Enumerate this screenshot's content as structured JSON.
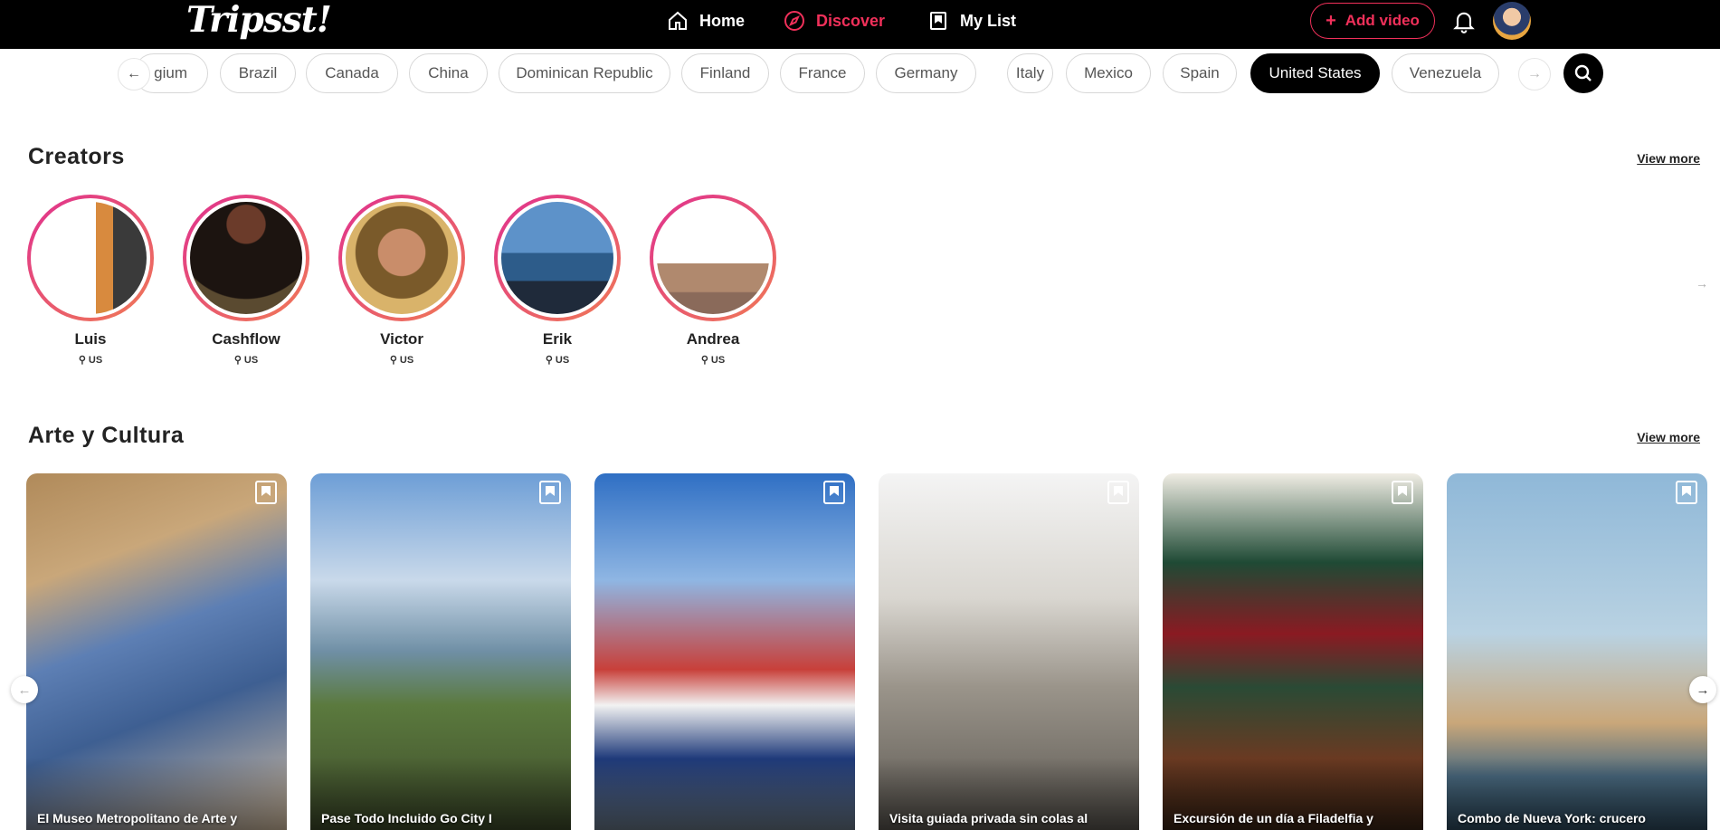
{
  "nav": {
    "logo": "Tripsst!",
    "home": "Home",
    "discover": "Discover",
    "my_list": "My List",
    "add_video": "Add video"
  },
  "countries": {
    "partial_first": "gium",
    "items": [
      "Brazil",
      "Canada",
      "China",
      "Dominican Republic",
      "Finland",
      "France",
      "Germany",
      "Italy",
      "Mexico",
      "Spain",
      "United States",
      "Venezuela"
    ],
    "selected": "United States"
  },
  "creators": {
    "title": "Creators",
    "view_more": "View more",
    "items": [
      {
        "name": "Luis",
        "location": "US"
      },
      {
        "name": "Cashflow",
        "location": "US"
      },
      {
        "name": "Victor",
        "location": "US"
      },
      {
        "name": "Erik",
        "location": "US"
      },
      {
        "name": "Andrea",
        "location": "US"
      }
    ]
  },
  "arte": {
    "title": "Arte y Cultura",
    "view_more": "View more",
    "cards": [
      {
        "title": "El Museo Metropolitano de Arte y"
      },
      {
        "title": "Pase Todo Incluido Go City I"
      },
      {
        "title": ""
      },
      {
        "title": "Visita guiada privada sin colas al"
      },
      {
        "title": "Excursión de un día a Filadelfia y"
      },
      {
        "title": "Combo de Nueva York: crucero"
      }
    ]
  },
  "colors": {
    "accent": "#f0305a",
    "nav_bg": "#000000"
  }
}
